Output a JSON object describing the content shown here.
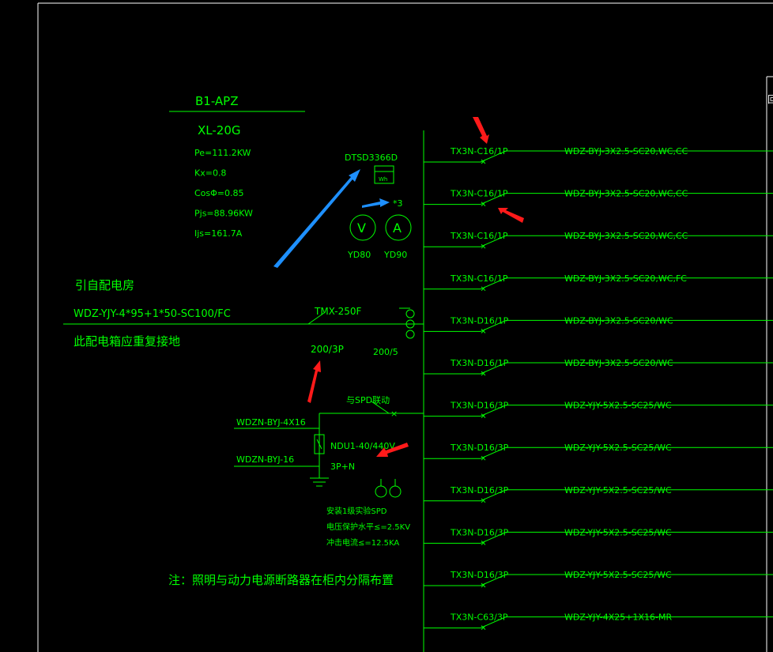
{
  "panel": {
    "name": "B1-APZ",
    "model": "XL-20G",
    "params": [
      "Pe=111.2KW",
      "Kx=0.8",
      "CosΦ=0.85",
      "Pjs=88.96KW",
      "Ijs=161.7A"
    ]
  },
  "incoming": {
    "source": "引自配电房",
    "cable": "WDZ-YJY-4*95+1*50-SC100/FC",
    "note": "此配电箱应重复接地"
  },
  "meter": {
    "label": "DTSD3366D",
    "box_text": "Wh"
  },
  "instruments": {
    "ct_count": "*3",
    "voltmeter": "V",
    "ammeter": "A",
    "v_label": "YD80",
    "a_label": "YD90"
  },
  "main_breaker": {
    "model": "TMX-250F",
    "rating": "200/3P",
    "ct_ratio": "200/5"
  },
  "spd": {
    "linkage": "与SPD联动",
    "cable_phase": "WDZN-BYJ-4X16",
    "cable_pe": "WDZN-BYJ-16",
    "model": "NDU1-40/440V",
    "poles": "3P+N",
    "notes": [
      "安装1级实验SPD",
      "电压保护水平≤=2.5KV",
      "冲击电流≤=12.5KA"
    ]
  },
  "footnote": "注：照明与动力电源断路器在柜内分隔布置",
  "circuits": [
    {
      "breaker": "TX3N-C16/1P",
      "cable": "WDZ-BYJ-3X2.5-SC20,WC,CC"
    },
    {
      "breaker": "TX3N-C16/1P",
      "cable": "WDZ-BYJ-3X2.5-SC20,WC,CC"
    },
    {
      "breaker": "TX3N-C16/1P",
      "cable": "WDZ-BYJ-3X2.5-SC20,WC,CC"
    },
    {
      "breaker": "TX3N-C16/1P",
      "cable": "WDZ-BYJ-3X2.5-SC20,WC,FC"
    },
    {
      "breaker": "TX3N-D16/1P",
      "cable": "WDZ-BYJ-3X2.5-SC20/WC"
    },
    {
      "breaker": "TX3N-D16/1P",
      "cable": "WDZ-BYJ-3X2.5-SC20/WC"
    },
    {
      "breaker": "TX3N-D16/3P",
      "cable": "WDZ-YJY-5X2.5-SC25/WC"
    },
    {
      "breaker": "TX3N-D16/3P",
      "cable": "WDZ-YJY-5X2.5-SC25/WC"
    },
    {
      "breaker": "TX3N-D16/3P",
      "cable": "WDZ-YJY-5X2.5-SC25/WC"
    },
    {
      "breaker": "TX3N-D16/3P",
      "cable": "WDZ-YJY-5X2.5-SC25/WC"
    },
    {
      "breaker": "TX3N-D16/3P",
      "cable": "WDZ-YJY-5X2.5-SC25/WC"
    },
    {
      "breaker": "TX3N-C63/3P",
      "cable": "WDZ-YJY-4X25+1X16-MR"
    }
  ],
  "colors": {
    "background": "#000000",
    "line": "#00ff00",
    "text": "#00ff00",
    "frame": "#ffffff",
    "annotation_red": "#ff1a1a",
    "annotation_blue": "#1e90ff"
  }
}
